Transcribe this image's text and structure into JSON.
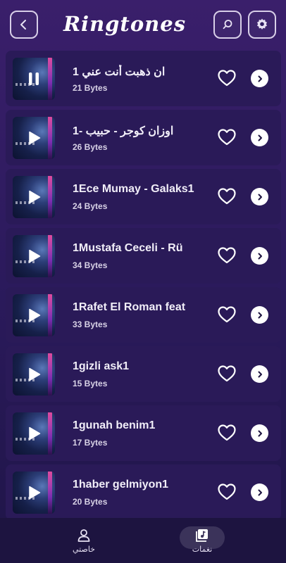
{
  "header": {
    "title": "Ringtones",
    "back_icon": "chevron-left-icon",
    "search_icon": "search-icon",
    "settings_icon": "gear-icon"
  },
  "ringtones": [
    {
      "title": "1 ان ذهبت أنت عني",
      "size": "21 Bytes",
      "state": "playing"
    },
    {
      "title": "1- اوزان كوجر - حبيب",
      "size": "26 Bytes",
      "state": "paused"
    },
    {
      "title": "1Ece Mumay - Galaks1",
      "size": "24 Bytes",
      "state": "paused"
    },
    {
      "title": "1Mustafa Ceceli - Rü",
      "size": "34 Bytes",
      "state": "paused"
    },
    {
      "title": "1Rafet El Roman feat",
      "size": "33 Bytes",
      "state": "paused"
    },
    {
      "title": "1gizli ask1",
      "size": "15 Bytes",
      "state": "paused"
    },
    {
      "title": "1gunah benim1",
      "size": "17 Bytes",
      "state": "paused"
    },
    {
      "title": "1haber gelmiyon1",
      "size": "20 Bytes",
      "state": "paused"
    }
  ],
  "bottom_nav": {
    "profile_label": "خاصتي",
    "tones_label": "نغمات",
    "active": "tones"
  },
  "colors": {
    "background_top": "#3a1f6b",
    "background_bottom": "#1f1548",
    "card": "#2a1a58",
    "nav": "#1d1440"
  }
}
